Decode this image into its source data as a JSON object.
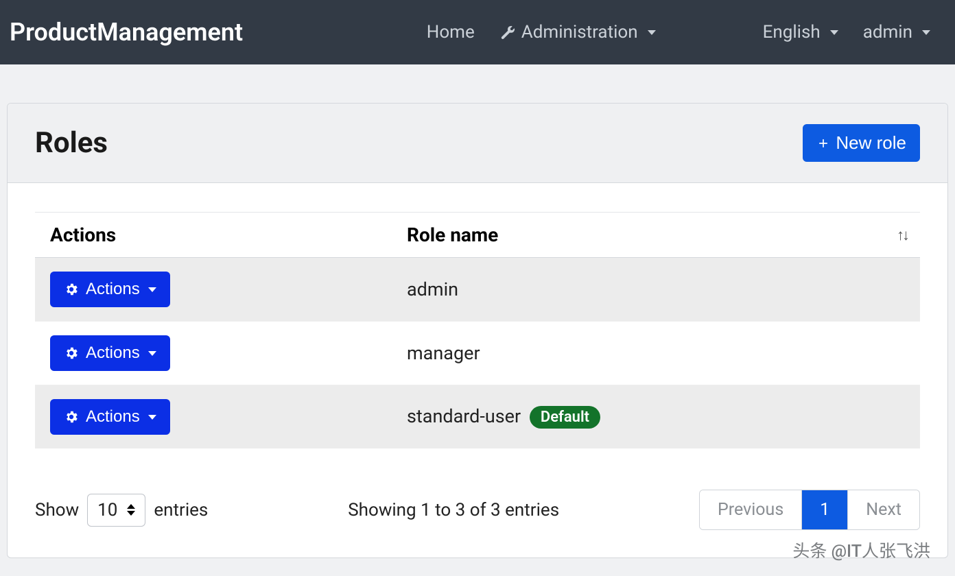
{
  "navbar": {
    "brand": "ProductManagement",
    "home": "Home",
    "administration": "Administration",
    "language": "English",
    "user": "admin"
  },
  "page": {
    "title": "Roles",
    "new_role_button": "New role"
  },
  "table": {
    "columns": {
      "actions": "Actions",
      "role_name": "Role name"
    },
    "actions_button": "Actions",
    "rows": [
      {
        "name": "admin",
        "default": false
      },
      {
        "name": "manager",
        "default": false
      },
      {
        "name": "standard-user",
        "default": true
      }
    ],
    "default_badge": "Default"
  },
  "footer": {
    "show_label": "Show",
    "page_size": "10",
    "entries_label": "entries",
    "info": "Showing 1 to 3 of 3 entries",
    "prev": "Previous",
    "page": "1",
    "next": "Next"
  },
  "watermark": "头条 @IT人张飞洪"
}
